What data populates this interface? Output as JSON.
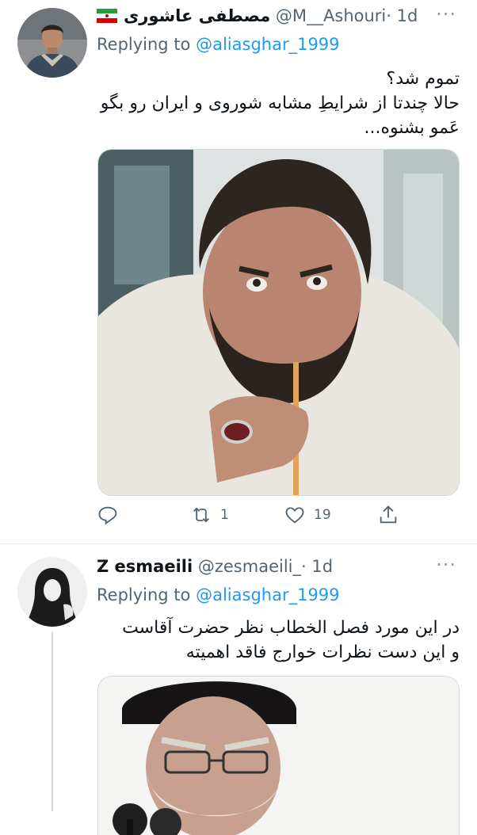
{
  "tweets": [
    {
      "name": "مصطفی عاشوری",
      "handle": "@M__Ashouri",
      "time": "· 1d",
      "replying_prefix": "Replying to",
      "replying_to": "@aliasghar_1999",
      "lines": [
        "تموم شد؟",
        "حالا چندتا از شرایطِ مشابه شوروی و ایران رو بگو",
        "عَمو بشنوه..."
      ],
      "flag_icon": "iran-flag",
      "stats": {
        "replies": "",
        "retweets": "1",
        "likes": "19"
      }
    },
    {
      "name": "Z esmaeili",
      "handle": "@zesmaeili_",
      "time": "· 1d",
      "replying_prefix": "Replying to",
      "replying_to": "@aliasghar_1999",
      "lines": [
        "در این مورد فصل الخطاب نظر حضرت آقاست",
        "و این دست نظرات خوارج فاقد اهمیته"
      ]
    }
  ],
  "icons": [
    "reply-icon",
    "retweet-icon",
    "like-icon",
    "share-icon",
    "more-icon"
  ],
  "colors": {
    "accent": "#1d9bf0",
    "secondary_text": "#536471",
    "divider": "#e6ecf0"
  }
}
